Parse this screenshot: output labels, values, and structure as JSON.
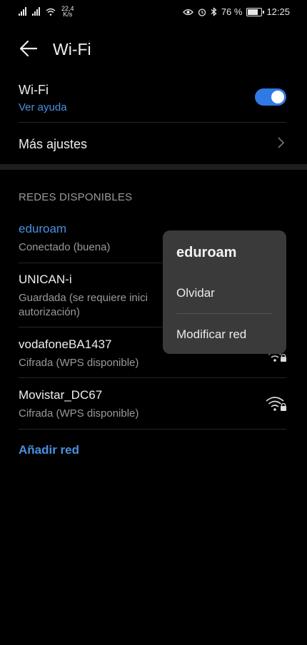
{
  "status_bar": {
    "speed_value": "22,4",
    "speed_unit": "K/s",
    "battery": "76 %",
    "battery_level": 0.76,
    "time": "12:25",
    "icons": [
      "signal-icon",
      "signal-icon",
      "wifi-icon",
      "eye-icon",
      "alarm-icon",
      "bluetooth-icon",
      "battery-icon"
    ]
  },
  "header": {
    "title": "Wi-Fi"
  },
  "wifi_toggle": {
    "label": "Wi-Fi",
    "help": "Ver ayuda",
    "on": true
  },
  "more_settings": {
    "label": "Más ajustes"
  },
  "section": {
    "title": "REDES DISPONIBLES"
  },
  "networks": [
    {
      "name": "eduroam",
      "status": "Conectado  (buena)",
      "connected": true
    },
    {
      "name": "UNICAN-i",
      "status_line1": "Guardada  (se requiere inici",
      "status_line2": "autorización)"
    },
    {
      "name": "vodafoneBA1437",
      "status": "Cifrada (WPS disponible)",
      "locked": true
    },
    {
      "name": "Movistar_DC67",
      "status": "Cifrada (WPS disponible)",
      "locked": true
    }
  ],
  "add_network": {
    "label": "Añadir red"
  },
  "context_menu": {
    "title": "eduroam",
    "items": [
      "Olvidar",
      "Modificar red"
    ]
  },
  "colors": {
    "accent": "#4a90e2",
    "toggle": "#2f7ae5",
    "menu_bg": "#3a3a3a"
  }
}
